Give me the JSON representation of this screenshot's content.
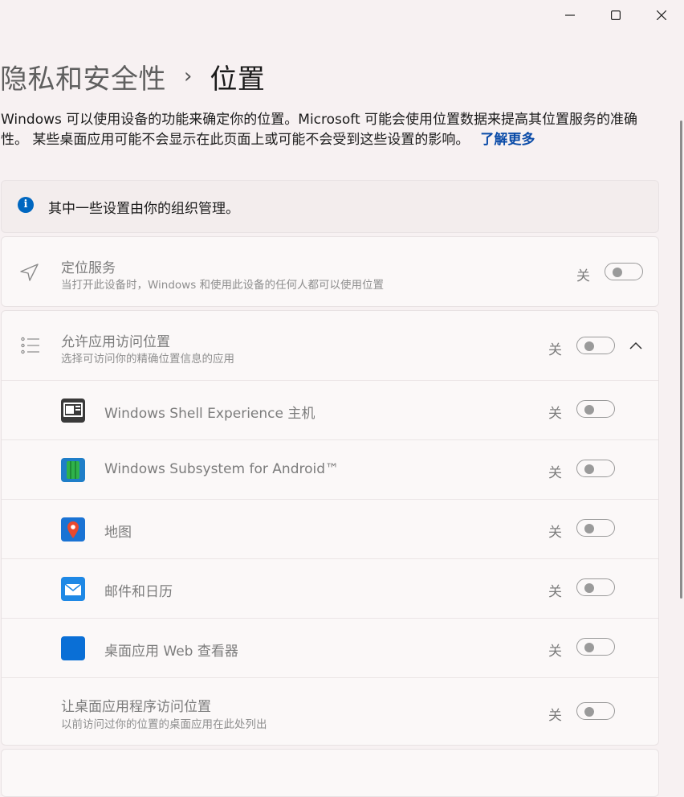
{
  "window": {
    "controls": [
      "minimize-icon",
      "maximize-icon",
      "close-icon"
    ]
  },
  "breadcrumb": {
    "parent": "隐私和安全性",
    "separator": "›",
    "current": "位置"
  },
  "description": {
    "text": "Windows 可以使用设备的功能来确定你的位置。Microsoft 可能会使用位置数据来提高其位置服务的准确性。 某些桌面应用可能不会显示在此页面上或可能不会受到这些设置的影响。",
    "link": "了解更多"
  },
  "info_banner": {
    "icon": "info-icon",
    "text": "其中一些设置由你的组织管理。"
  },
  "location_service": {
    "icon": "location-arrow-icon",
    "title": "定位服务",
    "subtitle": "当打开此设备时，Windows 和使用此设备的任何人都可以使用位置",
    "state": "关",
    "on": false
  },
  "app_access": {
    "icon": "list-icon",
    "title": "允许应用访问位置",
    "subtitle": "选择可访问你的精确位置信息的应用",
    "state": "关",
    "on": false,
    "expanded": true,
    "apps": [
      {
        "name": "Windows Shell Experience 主机",
        "icon": "shell-experience-icon",
        "state": "关",
        "on": false
      },
      {
        "name": "Windows Subsystem for Android™",
        "icon": "android-subsystem-icon",
        "state": "关",
        "on": false
      },
      {
        "name": "地图",
        "icon": "maps-icon",
        "state": "关",
        "on": false
      },
      {
        "name": "邮件和日历",
        "icon": "mail-calendar-icon",
        "state": "关",
        "on": false
      },
      {
        "name": "桌面应用 Web 查看器",
        "icon": "web-viewer-icon",
        "state": "关",
        "on": false
      }
    ],
    "desktop_apps": {
      "title": "让桌面应用程序访问位置",
      "subtitle": "以前访问过你的位置的桌面应用在此处列出",
      "state": "关",
      "on": false
    }
  },
  "colors": {
    "accent": "#0067c0",
    "link": "#0a4ba8",
    "background": "#f7f1f2"
  }
}
